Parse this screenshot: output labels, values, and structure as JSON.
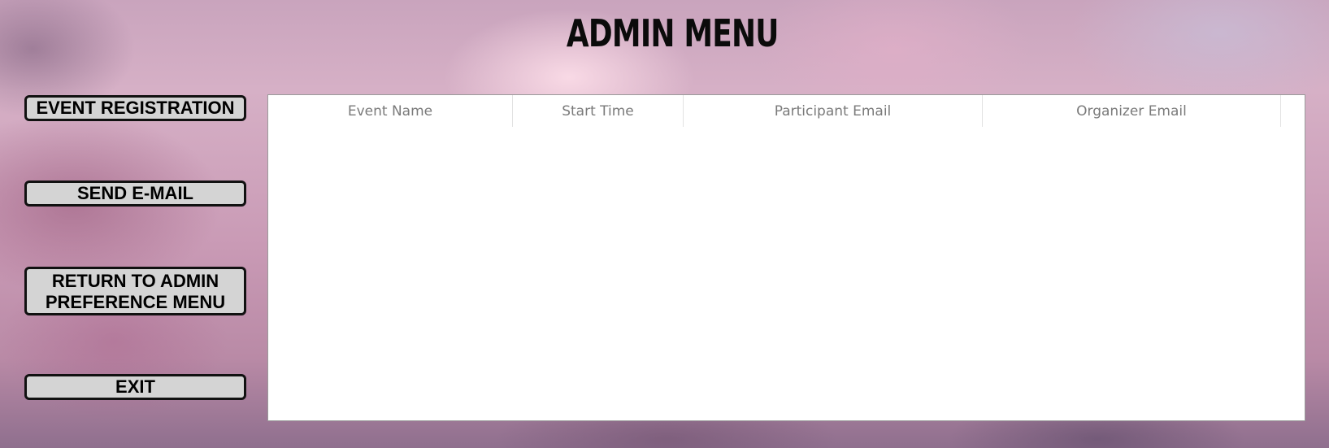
{
  "header": {
    "title": "ADMIN MENU"
  },
  "sidebar": {
    "buttons": [
      {
        "label": "EVENT REGISTRATION"
      },
      {
        "label": "SEND E-MAIL"
      },
      {
        "label": "RETURN TO ADMIN\nPREFERENCE MENU"
      },
      {
        "label": "EXIT"
      }
    ]
  },
  "table": {
    "columns": [
      "Event Name",
      "Start Time",
      "Participant Email",
      "Organizer Email"
    ],
    "rows": []
  },
  "colors": {
    "button_bg": "#d4d4d4",
    "button_border": "#111111",
    "table_bg": "#ffffff",
    "header_text": "#7a7a7a"
  }
}
